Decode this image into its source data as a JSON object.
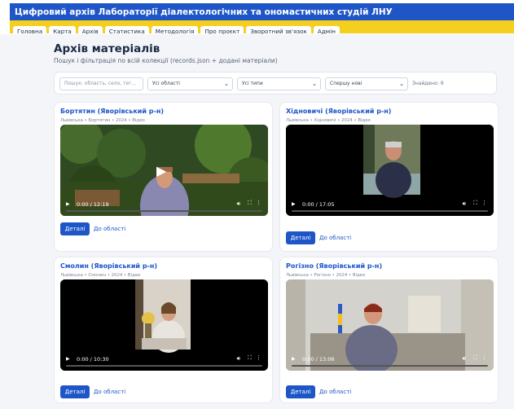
{
  "header": {
    "title": "Цифровий архів Лабораторії діалектологічних та ономастичних студій ЛНУ"
  },
  "nav": {
    "tabs": [
      {
        "label": "Головна"
      },
      {
        "label": "Карта"
      },
      {
        "label": "Архів"
      },
      {
        "label": "Статистика"
      },
      {
        "label": "Методологія"
      },
      {
        "label": "Про проєкт"
      },
      {
        "label": "Зворотний зв'язок"
      },
      {
        "label": "Адмін"
      }
    ]
  },
  "page": {
    "title": "Архів матеріалів",
    "subtitle": "Пошук і фільтрація по всій колекції (records.json + додані матеріали)"
  },
  "filters": {
    "search_placeholder": "Пошук: область, село, тег...",
    "region_value": "Усі області",
    "type_value": "Усі типи",
    "sort_value": "Спершу нові",
    "found_text": "Знайдено: 9"
  },
  "cards": [
    {
      "title": "Бортятин (Яворівський р-н)",
      "meta": "Львівська • Бортятин • 2024 • Відео",
      "time": "0:00 / 12:19",
      "details_label": "Деталі",
      "region_link": "До області"
    },
    {
      "title": "Хідновичі (Яворівський р-н)",
      "meta": "Львівська • Хідновичі • 2024 • Відео",
      "time": "0:00 / 17:05",
      "details_label": "Деталі",
      "region_link": "До області"
    },
    {
      "title": "Смолин (Яворівський р-н)",
      "meta": "Львівська • Смолин • 2024 • Відео",
      "time": "0:00 / 10:30",
      "details_label": "Деталі",
      "region_link": "До області"
    },
    {
      "title": "Рогізно (Яворівський р-н)",
      "meta": "Львівська • Рогізно • 2024 • Відео",
      "time": "0:00 / 13:06",
      "details_label": "Деталі",
      "region_link": "До області"
    }
  ],
  "colors": {
    "header_blue": "#1e56c8",
    "header_yellow": "#f5cf1f",
    "accent": "#1e56c8",
    "page_bg": "#f3f5f9"
  },
  "icons": {
    "play": "play-icon",
    "volume": "volume-icon",
    "fullscreen": "fullscreen-icon",
    "more": "more-options-icon",
    "chevron": "chevron-down-icon"
  }
}
